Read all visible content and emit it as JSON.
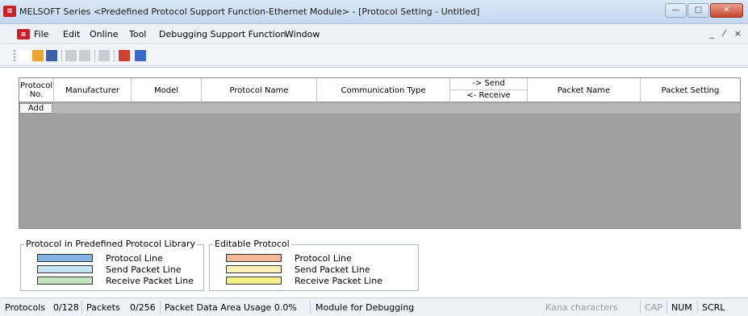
{
  "window": {
    "app_icon_glyph": "≡",
    "title": "MELSOFT Series <Predefined Protocol Support Function-Ethernet Module> - [Protocol Setting - Untitled]",
    "minimize_glyph": "—",
    "maximize_glyph": "□",
    "close_glyph": "✕"
  },
  "menubar": {
    "items": [
      "File",
      "Edit",
      "Online",
      "Tool",
      "Debugging Support Function",
      "Window"
    ],
    "mdi_controls": "_ ⁄ ×",
    "mdi_icon_glyph": "≡"
  },
  "toolbar": {
    "buttons": [
      {
        "icon": "new-file-icon",
        "color": "#ffffff"
      },
      {
        "icon": "open-folder-icon",
        "color": "#e8a530"
      },
      {
        "icon": "save-icon",
        "color": "#3b5fa8"
      },
      {
        "icon": "copy-icon",
        "color": "#c8ccd4"
      },
      {
        "icon": "paste-icon",
        "color": "#c8ccd4"
      },
      {
        "icon": "properties-icon",
        "color": "#c8ccd4"
      },
      {
        "icon": "read-from-module-icon",
        "color": "#d04030"
      },
      {
        "icon": "write-to-module-icon",
        "color": "#3a68c8"
      }
    ]
  },
  "grid": {
    "columns": {
      "protocol_no": "Protocol No.",
      "manufacturer": "Manufacturer",
      "model": "Model",
      "protocol_name": "Protocol Name",
      "communication_type": "Communication Type",
      "send": "-> Send",
      "receive": "<- Receive",
      "packet_name": "Packet Name",
      "packet_setting": "Packet Setting"
    },
    "add_label": "Add"
  },
  "legend_library": {
    "title": "Protocol in Predefined Protocol Library",
    "items": [
      {
        "label": "Protocol Line",
        "color": "#82b4e8"
      },
      {
        "label": "Send Packet Line",
        "color": "#c4e4f4"
      },
      {
        "label": "Receive Packet Line",
        "color": "#c4e4c0"
      }
    ]
  },
  "legend_editable": {
    "title": "Editable Protocol",
    "items": [
      {
        "label": "Protocol Line",
        "color": "#f7b896"
      },
      {
        "label": "Send Packet Line",
        "color": "#fcf0b8"
      },
      {
        "label": "Receive Packet Line",
        "color": "#f4f088"
      }
    ]
  },
  "statusbar": {
    "protocols_label": "Protocols",
    "protocols_value": "0/128",
    "packets_label": "Packets",
    "packets_value": "0/256",
    "packet_area": "Packet Data Area Usage  0.0%",
    "module": "Module for Debugging",
    "kana": "Kana characters",
    "cap": "CAP",
    "num": "NUM",
    "scrl": "SCRL"
  }
}
